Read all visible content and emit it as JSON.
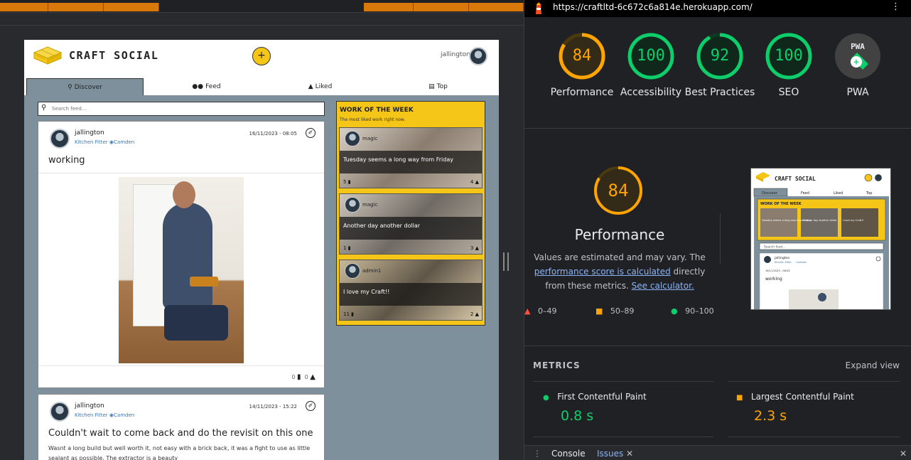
{
  "devtools": {
    "url": "https://craftltd-6c672c6a814e.herokuapp.com/",
    "drawer_tabs": [
      "Console",
      "Issues"
    ],
    "drawer_close": "✕",
    "issues_close": "✕",
    "kebab": "⋮"
  },
  "site": {
    "brand": "CRAFT SOCIAL",
    "add_label": "+",
    "username": "jallington",
    "tabs": [
      {
        "label": "Discover",
        "icon": "search-icon"
      },
      {
        "label": "Feed",
        "icon": "users-icon"
      },
      {
        "label": "Liked",
        "icon": "thumbs-up-icon"
      },
      {
        "label": "Top",
        "icon": "podium-icon"
      }
    ],
    "search_placeholder": "Search feed...",
    "posts": [
      {
        "user": "jallington",
        "job": "Kitchen Fitter",
        "location": "Camden",
        "date": "16/11/2023 - 08:05",
        "title": "working",
        "comments": "0",
        "likes": "0"
      },
      {
        "user": "jallington",
        "job": "Kitchen Fitter",
        "location": "Camden",
        "date": "14/11/2023 - 15:22",
        "title": "Couldn't wait to come back and do the revisit on this one",
        "body": "Wasnt a long build but well worth it, not easy with a brick back, it was a fight to use as little sealant as possible. The extractor is a beauty"
      }
    ],
    "work_of_week": {
      "title": "WORK OF THE WEEK",
      "subtitle": "The most liked work right now.",
      "cards": [
        {
          "user": "magic",
          "text": "Tuesday seems a long way from Friday",
          "comments": "5",
          "likes": "4"
        },
        {
          "user": "magic",
          "text": "Another day another dollar",
          "comments": "1",
          "likes": "3"
        },
        {
          "user": "admin1",
          "text": "I love my Craft!!",
          "comments": "11",
          "likes": "2"
        }
      ]
    }
  },
  "lighthouse": {
    "scores": [
      {
        "label": "Performance",
        "value": "84",
        "color": "#ffa400"
      },
      {
        "label": "Accessibility",
        "value": "100",
        "color": "#0cce6b"
      },
      {
        "label": "Best Practices",
        "value": "92",
        "color": "#0cce6b"
      },
      {
        "label": "SEO",
        "value": "100",
        "color": "#0cce6b"
      },
      {
        "label": "PWA",
        "value": "PWA",
        "color": "#9aa0a6"
      }
    ],
    "perf_title": "Performance",
    "perf_score": "84",
    "perf_desc_1": "Values are estimated and may vary. The",
    "perf_link_1": "performance score is calculated",
    "perf_desc_2": "directly from these metrics.",
    "perf_link_2": "See calculator.",
    "legend": [
      "0–49",
      "50–89",
      "90–100"
    ],
    "metrics_heading": "METRICS",
    "expand_view": "Expand view",
    "metrics": [
      {
        "name": "First Contentful Paint",
        "value": "0.8 s",
        "color": "#0cce6b"
      },
      {
        "name": "Largest Contentful Paint",
        "value": "2.3 s",
        "color": "#ffa400"
      }
    ]
  },
  "thumbnail": {
    "brand": "CRAFT SOCIAL",
    "tabs": [
      "Discover",
      "Feed",
      "Liked",
      "Top"
    ],
    "wotw": "WORK OF THE WEEK",
    "search": "Search feed...",
    "user": "jallington",
    "job": "Kitchen Fitter",
    "location": "Camden",
    "date": "16/11/2023 - 08:05",
    "title": "working",
    "cards": [
      "Tuesday seems a long way from Friday",
      "Another day another dollar",
      "I love my Craft!!"
    ]
  }
}
